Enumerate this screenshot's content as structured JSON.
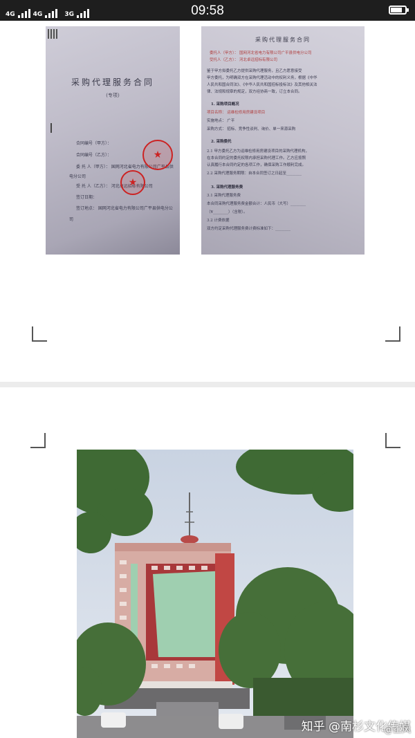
{
  "status_bar": {
    "network_1": "4G",
    "network_2": "4G",
    "network_3": "3G",
    "time": "09:58",
    "battery_level": 0.9
  },
  "contract_cover": {
    "title": "采购代理服务合同",
    "subtitle": "(专项)",
    "fields": [
      "合同编号（甲方）：",
      "合同编号（乙方）：",
      "委 托 人（甲方）：  国网河北省电力有限公司广平县供",
      "电分公司",
      "受 托 人（乙方）：  河北卓远招标有限公司",
      "签订日期：",
      "签订地点：  国网河北省电力有限公司广平县供电分公",
      "司"
    ]
  },
  "contract_terms": {
    "title": "采购代理服务合同",
    "lines": [
      {
        "text": "委托人（甲方）：  国网河北省电力有限公司广平县供电分公司",
        "style": "hl"
      },
      {
        "text": "受托人（乙方）：  河北卓远招标有限公司",
        "style": "hl"
      },
      {
        "text": "鉴于甲方拟委托乙方提供采购代理服务，且乙方愿意接受",
        "style": ""
      },
      {
        "text": "甲方委托，为明确双方在采购代理活动中的权利义务，根据《中华",
        "style": ""
      },
      {
        "text": "人民共和国合同法》、《中华人民共和国招标投标法》及其他相关法",
        "style": ""
      },
      {
        "text": "律、法规和规章的规定，双方经协商一致，订立本合同。",
        "style": ""
      },
      {
        "text": "1.  采购项目概况",
        "style": "sec"
      },
      {
        "text": "项目名称：  运维检修用房建设项目",
        "style": "hl"
      },
      {
        "text": "实施地点：  广平",
        "style": ""
      },
      {
        "text": "采购方式：  招标、竞争性谈判、询价、单一来源采购",
        "style": ""
      },
      {
        "text": "2.  采购委托",
        "style": "sec"
      },
      {
        "text": "2.1  甲方委托乙方为运维检修用房建设项目的采购代理机构，",
        "style": ""
      },
      {
        "text": "在本合同约定的委托权限内承担采购代理工作。乙方应按照",
        "style": ""
      },
      {
        "text": "认真履行本合同约定的各项工作，确保采购工作顺利完成。",
        "style": ""
      },
      {
        "text": "2.2  采购代理服务期限：自本合同签订之日起至________",
        "style": ""
      },
      {
        "text": "3.  采购代理服务费",
        "style": "sec"
      },
      {
        "text": "3.1  采购代理服务费",
        "style": ""
      },
      {
        "text": "本合同采购代理服务费金额合计：人民币（大写）________",
        "style": ""
      },
      {
        "text": "（¥________）（含税）。",
        "style": ""
      },
      {
        "text": "3.2  计费依据",
        "style": ""
      },
      {
        "text": "双方约定采购代理服务费计费标准如下：________",
        "style": ""
      }
    ]
  },
  "watermark": {
    "platform": "知乎",
    "account": "@南杉文化传媒",
    "source": "@正风"
  }
}
